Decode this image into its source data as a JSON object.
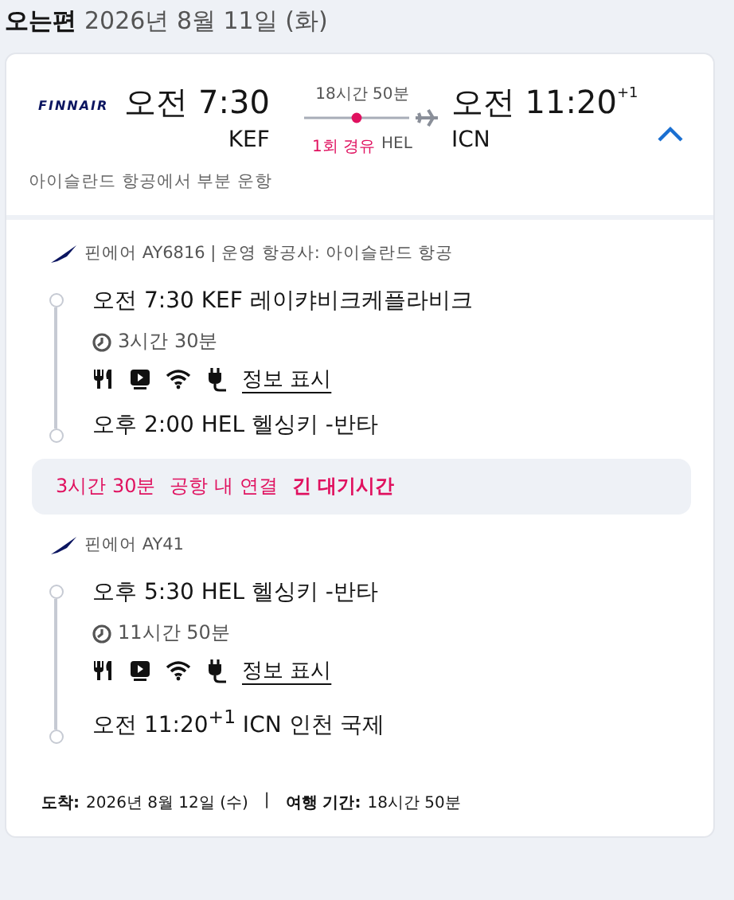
{
  "heading": {
    "label": "오는편",
    "date": "2026년 8월 11일 (화)"
  },
  "summary": {
    "airline_logo": "FINNAIR",
    "depart_time": "오전 7:30",
    "depart_code": "KEF",
    "duration": "18시간 50분",
    "stops": "1회 경유",
    "stop_airport": "HEL",
    "arrive_time": "오전 11:20",
    "arrive_day_offset": "+1",
    "arrive_code": "ICN",
    "expanded": true,
    "operated_note": "아이슬란드 항공에서 부분 운항"
  },
  "segments": [
    {
      "flight": "핀에어 AY6816 | 운영 항공사: 아이슬란드 항공",
      "depart": "오전 7:30 KEF 레이캬비크케플라비크",
      "duration": "3시간 30분",
      "details_link": "정보 표시",
      "arrive": "오후 2:00 HEL 헬싱키 -반타"
    },
    {
      "flight": "핀에어 AY41",
      "depart": "오후 5:30 HEL 헬싱키 -반타",
      "duration": "11시간 50분",
      "details_link": "정보 표시",
      "arrive": "오전 11:20$^{+1}$ ICN 인천 국제"
    }
  ],
  "layover": {
    "duration": "3시간 30분",
    "connection": "공항 내 연결",
    "warning": "긴 대기시간"
  },
  "footer": {
    "arrival_label": "도착:",
    "arrival_date": "2026년 8월 12일 (수)",
    "separator": "|",
    "trip_label": "여행 기간:",
    "trip_duration": "18시간 50분"
  }
}
